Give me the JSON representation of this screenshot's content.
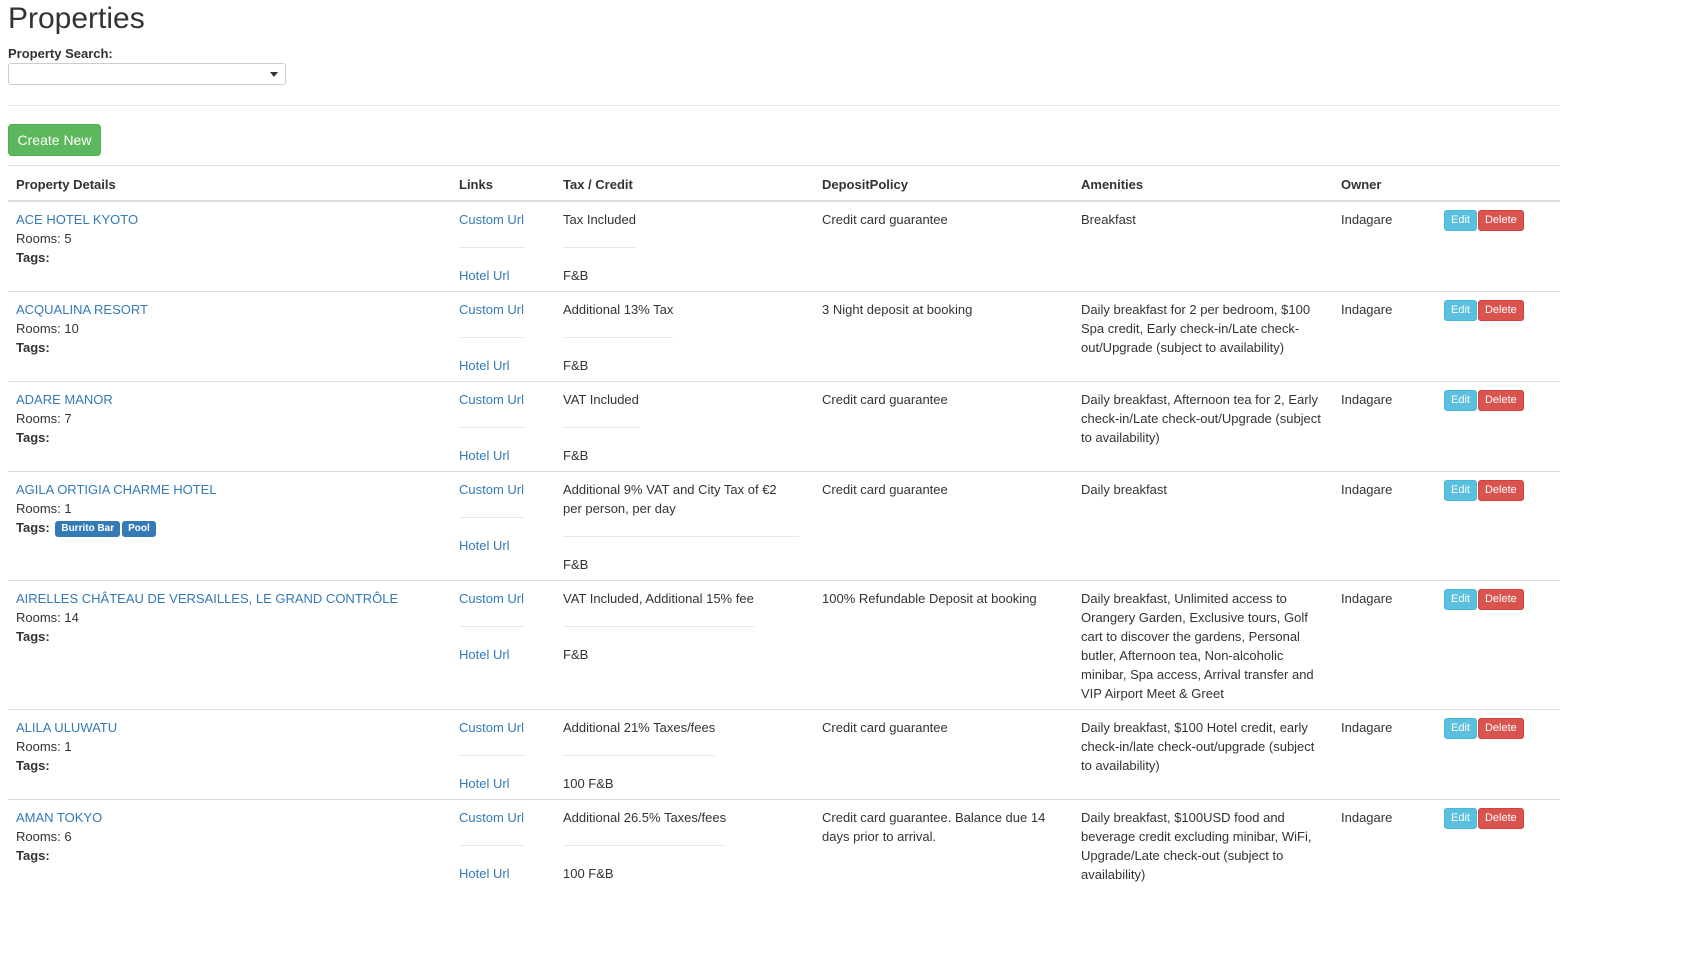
{
  "page": {
    "title": "Properties"
  },
  "search": {
    "label": "Property Search:",
    "value": ""
  },
  "toolbar": {
    "create_label": "Create New"
  },
  "table": {
    "headers": {
      "details": "Property Details",
      "links": "Links",
      "tax": "Tax / Credit",
      "deposit": "DepositPolicy",
      "amenities": "Amenities",
      "owner": "Owner"
    },
    "labels": {
      "rooms_prefix": "Rooms: ",
      "tags": "Tags:",
      "custom_url": "Custom Url",
      "hotel_url": "Hotel Url",
      "edit": "Edit",
      "delete": "Delete"
    },
    "rows": [
      {
        "name": "ACE HOTEL KYOTO",
        "rooms": "5",
        "tags": [],
        "tax": "Tax Included",
        "credit": "F&B",
        "deposit": "Credit card guarantee",
        "amenities": "Breakfast",
        "owner": "Indagare"
      },
      {
        "name": "ACQUALINA RESORT",
        "rooms": "10",
        "tags": [],
        "tax": "Additional 13% Tax",
        "credit": "F&B",
        "deposit": "3 Night deposit at booking",
        "amenities": "Daily breakfast for 2 per bedroom, $100 Spa credit, Early check-in/Late check-out/Upgrade (subject to availability)",
        "owner": "Indagare"
      },
      {
        "name": "ADARE MANOR",
        "rooms": "7",
        "tags": [],
        "tax": "VAT Included",
        "credit": "F&B",
        "deposit": "Credit card guarantee",
        "amenities": "Daily breakfast, Afternoon tea for 2, Early check-in/Late check-out/Upgrade (subject to availability)",
        "owner": "Indagare"
      },
      {
        "name": "AGILA ORTIGIA CHARME HOTEL",
        "rooms": "1",
        "tags": [
          "Burrito Bar",
          "Pool"
        ],
        "tax": "Additional 9% VAT and City Tax of €2 per person, per day",
        "credit": "F&B",
        "deposit": "Credit card guarantee",
        "amenities": "Daily breakfast",
        "owner": "Indagare"
      },
      {
        "name": "AIRELLES CHÂTEAU DE VERSAILLES, LE GRAND CONTRÔLE",
        "rooms": "14",
        "tags": [],
        "tax": "VAT Included, Additional 15% fee",
        "credit": "F&B",
        "deposit": "100% Refundable Deposit at booking",
        "amenities": "Daily breakfast, Unlimited access to Orangery Garden, Exclusive tours, Golf cart to discover the gardens, Personal butler, Afternoon tea, Non-alcoholic minibar, Spa access, Arrival transfer and VIP Airport Meet & Greet",
        "owner": "Indagare"
      },
      {
        "name": "ALILA ULUWATU",
        "rooms": "1",
        "tags": [],
        "tax": "Additional 21% Taxes/fees",
        "credit": "100 F&B",
        "deposit": "Credit card guarantee",
        "amenities": "Daily breakfast, $100 Hotel credit, early check-in/late check-out/upgrade (subject to availability)",
        "owner": "Indagare"
      },
      {
        "name": "AMAN TOKYO",
        "rooms": "6",
        "tags": [],
        "tax": "Additional 26.5% Taxes/fees",
        "credit": "100 F&B",
        "deposit": "Credit card guarantee. Balance due 14 days prior to arrival.",
        "amenities": "Daily breakfast, $100USD food and beverage credit excluding minibar, WiFi, Upgrade/Late check-out (subject to availability)",
        "owner": "Indagare"
      }
    ]
  }
}
